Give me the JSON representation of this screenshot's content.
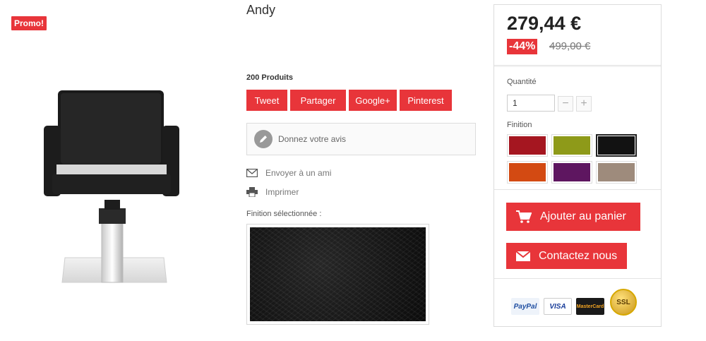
{
  "badges": {
    "promo": "Promo!"
  },
  "product": {
    "title": "Andy",
    "count_label": "200 Produits"
  },
  "social": {
    "tweet": "Tweet",
    "share": "Partager",
    "google": "Google+",
    "pinterest": "Pinterest"
  },
  "review": {
    "label": "Donnez votre avis"
  },
  "actions": {
    "send_friend": "Envoyer à un ami",
    "print": "Imprimer"
  },
  "selected_finish": {
    "label": "Finition sélectionnée :"
  },
  "pricing": {
    "current": "279,44 €",
    "discount": "-44%",
    "old": "499,00 €"
  },
  "options": {
    "quantity_label": "Quantité",
    "quantity_value": "1",
    "minus": "−",
    "plus": "+",
    "finish_label": "Finition",
    "swatches": [
      {
        "name": "red",
        "color": "#a51620",
        "selected": false
      },
      {
        "name": "olive",
        "color": "#8e9a19",
        "selected": false
      },
      {
        "name": "black",
        "color": "#121212",
        "selected": true
      },
      {
        "name": "orange",
        "color": "#d34a12",
        "selected": false
      },
      {
        "name": "purple",
        "color": "#5e1660",
        "selected": false
      },
      {
        "name": "taupe",
        "color": "#9e8b7c",
        "selected": false
      }
    ]
  },
  "cta": {
    "add_to_cart": "Ajouter au panier",
    "contact": "Contactez nous"
  },
  "payment": {
    "paypal": "PayPal",
    "visa": "VISA",
    "mastercard": "MasterCard",
    "ssl": "SSL"
  },
  "colors": {
    "accent": "#e8353a"
  },
  "icons": {
    "review": "pencil-icon",
    "send_friend": "envelope-icon",
    "print": "printer-icon",
    "cart": "cart-icon",
    "contact": "envelope-icon"
  }
}
